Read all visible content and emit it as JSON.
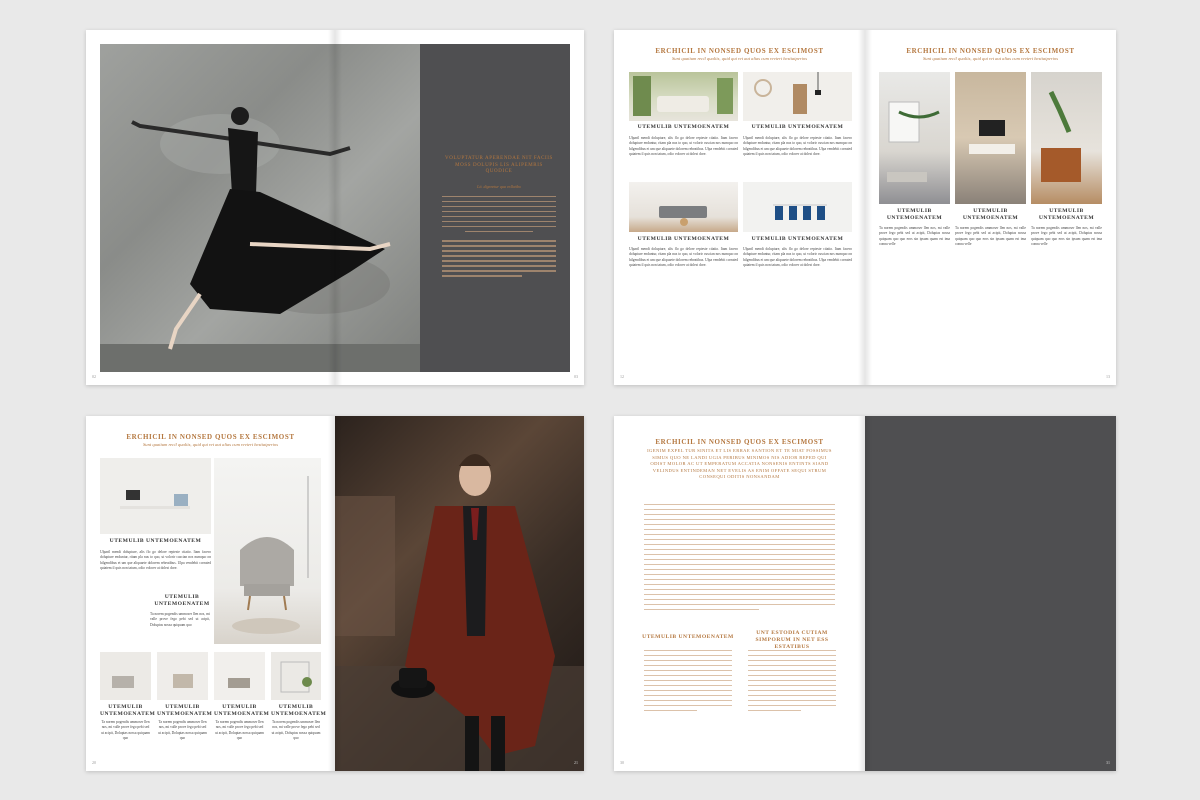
{
  "spread1": {
    "heading": "VOLUPTATUR APERENDAE NIT FACIIS MOSS DOLUPIS LIS ALIPEMRIS QUODICE",
    "intro": "Lit. digenetur qua vellatibo",
    "page_left": "02",
    "page_right": "03"
  },
  "spread2": {
    "left_header": "ERCHICIL IN NONSED QUOS EX ESCIMOST",
    "left_sub": "Sunt quatium recil qualiis, quid qui ret aut alias cum reviert hestiatperios",
    "right_header": "ERCHICIL IN NONSED QUOS EX ESCIMOST",
    "right_sub": "Sunt quatium recil qualiis, quid qui ret aut alias cum reviert hestiatperios",
    "caption_a": "UTEMULIB UNTEMOENATEM",
    "caption_b": "UTEMULIB UNTEMOENATEM",
    "caption_c": "UTEMULIB UNTEMOENATEM",
    "caption_d": "UTEMULIB UNTEMOENATEM",
    "col1": "UTEMULIB UNTEMOENATEM",
    "col2": "UTEMULIB UNTEMOENATEM",
    "col3": "UTEMULIB UNTEMOENATEM",
    "body_snippet": "Ulparil mendi dolupture, alis flo go delore repteste ctiatio. Itam facero dolupture enduntur, ritam pla nus to quo, ut volorir cuscian nos numquo on hilgendibus et um que aliquaete dolorem rebeatibus. Ulpa vendebit corrated quiatem il quis non tatum, odio volorer at dolest dore.",
    "col_snippet": "Ta norem pogendis ummoser llen nos, mi valle prove fego pebi sed ut acipit, Doluptas nossa quiquam quo quo eros sin ipsum quam est ima conna velle",
    "page_left": "12",
    "page_right": "13"
  },
  "spread3": {
    "header": "ERCHICIL IN NONSED QUOS EX ESCIMOST",
    "sub": "Sunt quatium recil qualiis, quid qui ret aut alias cum reviert hestiatperios",
    "caption_main": "UTEMULIB UNTEMOENATEM",
    "caption_side": "UTEMULIB UNTEMOENATEM",
    "thumb_caps": [
      "UTEMULIB UNTEMOENATEM",
      "UTEMULIB UNTEMOENATEM",
      "UTEMULIB UNTEMOENATEM",
      "UTEMULIB UNTEMOENATEM"
    ],
    "body_snippet": "Ulparil mendi dolupture, alis flo go delore repteste ctiatio. Itam facero dolupture enduntur, ritam pla nus to quo, ut volorir cuscian nos numquo on hilgendibus et um que aliquaete dolorem rebeatibus. Ulpa vendebit corrated quiatem il quis non tatum, odio volorer at dolest dore.",
    "col_snippet": "Ta norem pogendis ummoser llen nos, mi valle prove fego pebi sed ut acipit, Doluptas nossa quiquam quo",
    "page_left": "20",
    "page_right": "21"
  },
  "spread4": {
    "header": "ERCHICIL IN NONSED QUOS EX ESCIMOST",
    "deck": "IGENIM EXPEL TUR SINITA ET LIS ERRAE SANTION ET TE MIAT FOSSIMUS SIMUS QUO NE LANDI UGIA PERIBUS MINIMOS NIS ADIOR REPED QUI ODIST MOLOR AC UT EMPERATUM ACCATIA NONSENIS ENTINTS SIAND VELINDUS ENTINDEMAN NET EVELIS AS ENIM OFFATE SEQUI STRUM CONSEQUI ODITIS NONSANDAM",
    "col_a_title": "UTEMULIB UNTEMOENATEM",
    "col_b_title": "UNT ESTODIA CUTIAM SIMPORUM IN NET ESS ESTATIBUS",
    "col_snippet": "Ipsam ea vollibi intrusum que mi volupti aut qui dolestrum ernation tem exereat redibus aut quam de temporum delias ent quiscia, velamque consequi",
    "page_left": "30",
    "page_right": "31"
  }
}
